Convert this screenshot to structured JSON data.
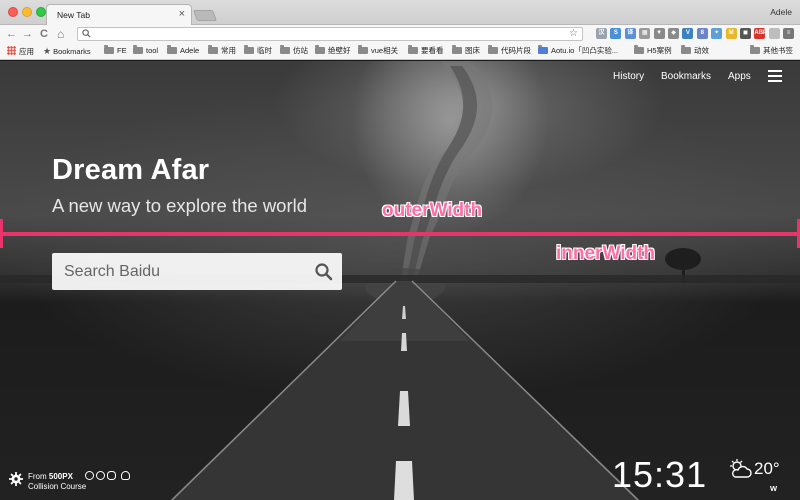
{
  "window": {
    "tab_title": "New Tab",
    "tab_close": "×",
    "profile_name": "Adele"
  },
  "toolbar": {
    "back": "←",
    "forward": "→",
    "reload": "C",
    "home": "⌂",
    "search_icon": "🔍",
    "address_value": "",
    "star": "☆",
    "extensions": [
      {
        "name": "ext-1",
        "label": "汉",
        "color": "#9aa3ad"
      },
      {
        "name": "ext-2",
        "label": "S",
        "color": "#4a90d9"
      },
      {
        "name": "ext-3",
        "label": "译",
        "color": "#5b8fd8"
      },
      {
        "name": "ext-4",
        "label": "▦",
        "color": "#9a9a9a"
      },
      {
        "name": "ext-5",
        "label": "▼",
        "color": "#8a8a8a"
      },
      {
        "name": "ext-6",
        "label": "◆",
        "color": "#8a8a8a"
      },
      {
        "name": "ext-7",
        "label": "V",
        "color": "#3b82c4"
      },
      {
        "name": "ext-8",
        "label": "8",
        "color": "#6a84c7"
      },
      {
        "name": "ext-9",
        "label": "✦",
        "color": "#5da0d8"
      },
      {
        "name": "ext-10",
        "label": "M",
        "color": "#e9b72a"
      },
      {
        "name": "ext-11",
        "label": "◼",
        "color": "#555"
      },
      {
        "name": "ext-12",
        "label": "ABP",
        "color": "#d9342b"
      },
      {
        "name": "ext-13",
        "label": "",
        "color": "#bdbdbd"
      },
      {
        "name": "ext-14",
        "label": "≡",
        "color": "#777"
      }
    ]
  },
  "bookmarks": {
    "apps": "应用",
    "bookmarks": "Bookmarks",
    "items": [
      "FE",
      "tool",
      "Adele",
      "常用",
      "临时",
      "仿站",
      "绝壁好",
      "vue相关",
      "要看看",
      "图床",
      "代码片段",
      "Aotu.io「凹凸实验...",
      "H5案例",
      "动效"
    ],
    "other": "其他书签"
  },
  "page": {
    "nav": {
      "history": "History",
      "bookmarks": "Bookmarks",
      "apps": "Apps"
    },
    "title": "Dream Afar",
    "subtitle": "A new way to explore the world",
    "search_placeholder": "Search Baidu",
    "annotations": {
      "outer": "outerWidth",
      "inner": "innerWidth"
    },
    "credit": {
      "from_prefix": "From",
      "source": "500PX",
      "photo_title": "Collision Course"
    },
    "clock": "15:31",
    "weather": {
      "temp": "20°",
      "wind": "W"
    }
  },
  "colors": {
    "accent_line": "#e9336b",
    "annotation_text": "#ff6fa5"
  }
}
